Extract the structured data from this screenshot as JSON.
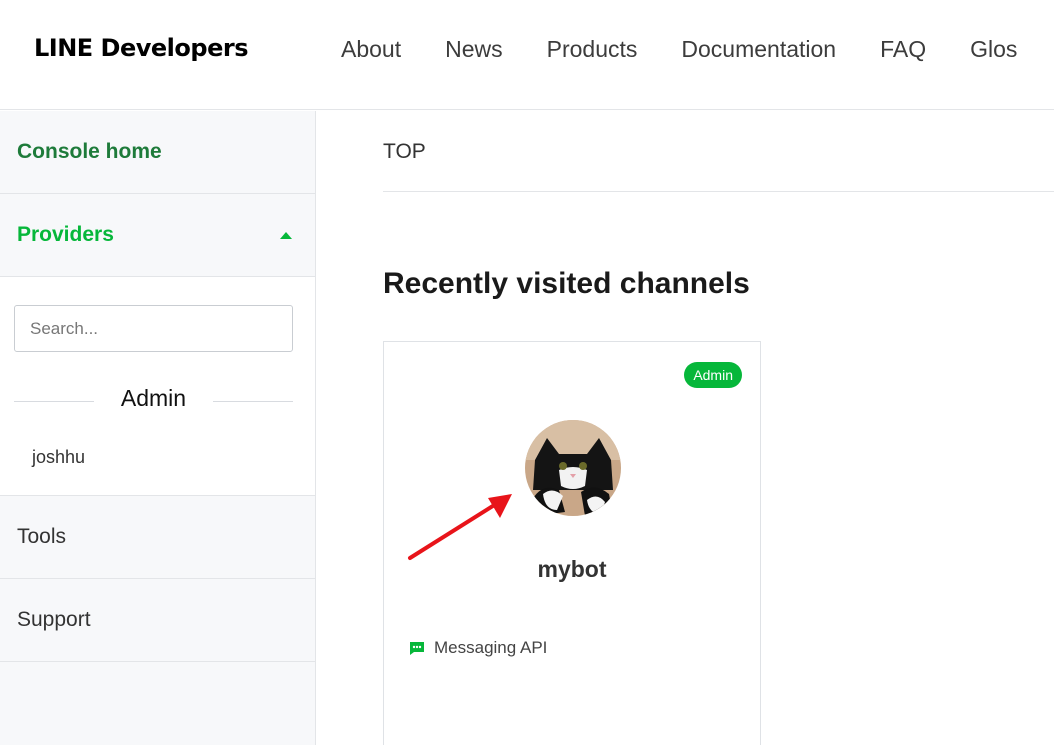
{
  "header": {
    "logo": "LINE Developers",
    "nav": [
      "About",
      "News",
      "Products",
      "Documentation",
      "FAQ",
      "Glos"
    ]
  },
  "sidebar": {
    "console_home": "Console home",
    "providers": "Providers",
    "search_placeholder": "Search...",
    "group_label": "Admin",
    "provider_items": [
      "joshhu"
    ],
    "tools": "Tools",
    "support": "Support"
  },
  "main": {
    "breadcrumb": "TOP",
    "section_title": "Recently visited channels",
    "channel": {
      "role_badge": "Admin",
      "name": "mybot",
      "type": "Messaging API"
    }
  },
  "colors": {
    "brand_green": "#06b73a",
    "console_green": "#1e7b3a",
    "annotation_arrow": "#e8141a"
  },
  "icons": {
    "providers_toggle": "chevron-up-icon",
    "channel_type": "chat-bubble-icon"
  }
}
